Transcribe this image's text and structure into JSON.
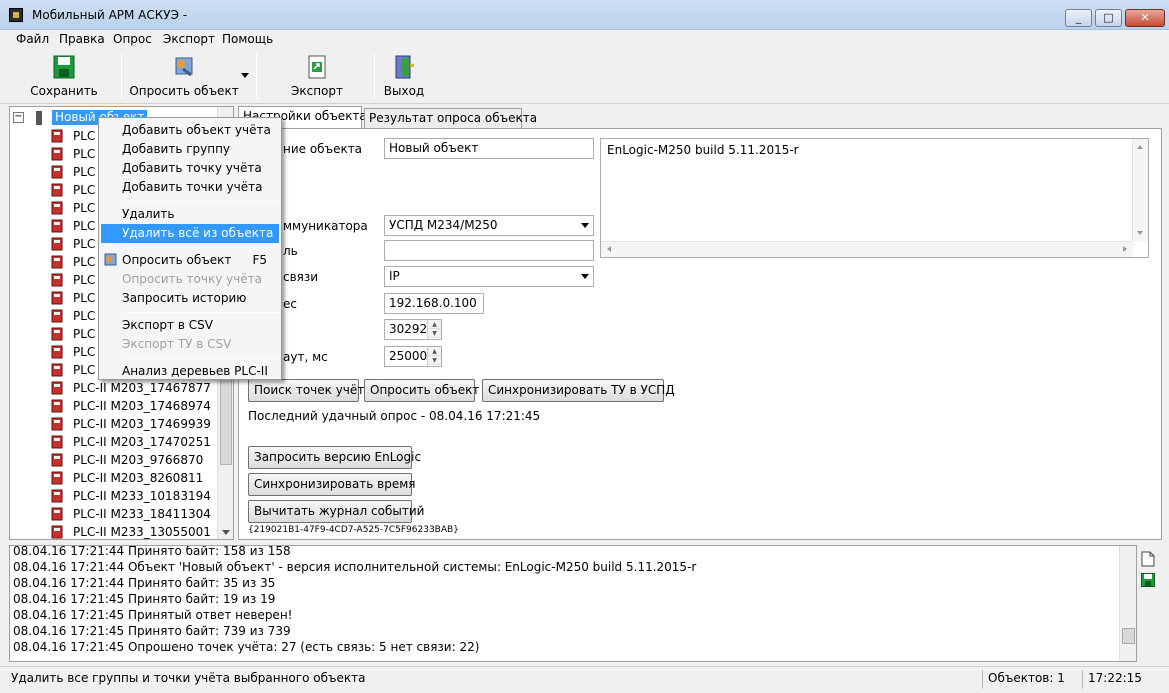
{
  "window": {
    "title": "Мобильный АРМ АСКУЭ -",
    "minimize": "_",
    "maximize": "□",
    "close": "✕"
  },
  "menubar": [
    "Файл",
    "Правка",
    "Опрос",
    "Экспорт",
    "Помощь"
  ],
  "toolbar": {
    "save": "Сохранить",
    "poll_object": "Опросить объект",
    "export": "Экспорт",
    "exit": "Выход"
  },
  "tree": {
    "root": "Новый объект",
    "items": [
      "PLC",
      "PLC",
      "PLC",
      "PLC",
      "PLC",
      "PLC",
      "PLC",
      "PLC",
      "PLC",
      "PLC",
      "PLC",
      "PLC",
      "PLC",
      "PLC",
      "PLC-II M203_17467877",
      "PLC-II M203_17468974",
      "PLC-II M203_17469939",
      "PLC-II M203_17470251",
      "PLC-II M203_9766870",
      "PLC-II M203_8260811",
      "PLC-II M233_10183194",
      "PLC-II M233_18411304",
      "PLC-II M233_13055001"
    ]
  },
  "tabs": [
    "Настройки объекта",
    "Результат опроса объекта"
  ],
  "settings": {
    "name_label": "ние объекта",
    "name_value": "Новый объект",
    "comm_label": "ммуникатора",
    "comm_value": "УСПД M234/M250",
    "password_label": "ль",
    "password_value": "",
    "link_label": "связи",
    "link_value": "IP",
    "ip_label": "ес",
    "ip_value": "192.168.0.100",
    "port_value": "30292",
    "timeout_label": "аут, мс",
    "timeout_value": "25000",
    "version_text": "EnLogic-M250 build  5.11.2015-r",
    "btn_search_points": "Поиск точек учёта",
    "btn_poll_object": "Опросить объект",
    "btn_sync_tu": "Синхронизировать ТУ в УСПД",
    "last_poll": "Последний удачный опрос - 08.04.16 17:21:45",
    "btn_request_version": "Запросить версию EnLogic",
    "btn_sync_time": "Синхронизировать время",
    "btn_read_log": "Вычитать журнал событий",
    "guid": "{219021B1-47F9-4CD7-A525-7C5F96233BAB}"
  },
  "context_menu": {
    "items": [
      {
        "label": "Добавить объект учёта",
        "disabled": false
      },
      {
        "label": "Добавить группу",
        "disabled": false
      },
      {
        "label": "Добавить точку учёта",
        "disabled": false
      },
      {
        "label": "Добавить точки учёта",
        "disabled": false
      },
      {
        "label": "Удалить",
        "disabled": false
      },
      {
        "label": "Удалить всё из объекта",
        "disabled": false
      },
      {
        "label": "Опросить объект",
        "shortcut": "F5",
        "disabled": false
      },
      {
        "label": "Опросить точку учёта",
        "disabled": true
      },
      {
        "label": "Запросить историю",
        "disabled": false
      },
      {
        "label": "Экспорт в CSV",
        "disabled": false
      },
      {
        "label": "Экспорт ТУ в CSV",
        "disabled": true
      },
      {
        "label": "Анализ деревьев PLC-II",
        "disabled": false
      }
    ]
  },
  "log": [
    "08.04.16 17:21:44  Принято байт: 158 из 158",
    "08.04.16 17:21:44  Объект 'Новый объект' - версия исполнительной системы: EnLogic-M250 build  5.11.2015-r",
    "08.04.16 17:21:44  Принято байт: 35 из 35",
    "08.04.16 17:21:45  Принято байт: 19 из 19",
    "08.04.16 17:21:45  Принятый ответ неверен!",
    "08.04.16 17:21:45  Принято байт: 739 из 739",
    "08.04.16 17:21:45  Опрошено точек учёта: 27 (есть связь: 5  нет связи: 22)"
  ],
  "status": {
    "message": "Удалить все группы и точки учёта выбранного объекта",
    "objects": "Объектов: 1",
    "time": "17:22:15"
  },
  "colors": {
    "selection": "#3399ff",
    "title_gradient": "#cfe0f4"
  }
}
